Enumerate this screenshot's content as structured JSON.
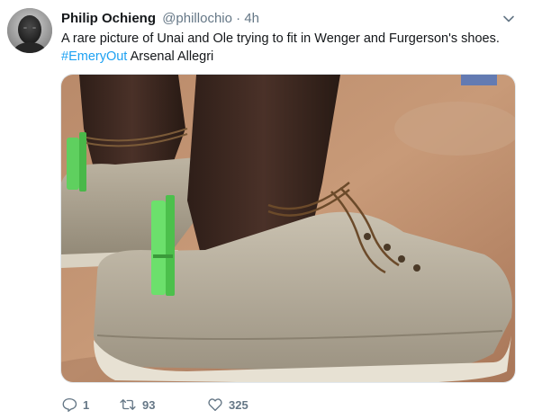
{
  "tweet": {
    "display_name": "Philip Ochieng",
    "handle": "@phillochio",
    "separator": "·",
    "time": "4h",
    "text_line1": "A rare picture of Unai and Ole trying to fit in Wenger and Furgerson's shoes.",
    "hashtag": "#EmeryOut",
    "text_rest": " Arsenal Allegri",
    "media_icon": "photo-of-shoes-tied-with-rope",
    "actions": {
      "reply_icon": "reply-icon",
      "reply_count": "1",
      "retweet_icon": "retweet-icon",
      "retweet_count": "93",
      "like_icon": "heart-icon",
      "like_count": "325"
    }
  },
  "colors": {
    "text": "#14171a",
    "muted": "#657786",
    "link": "#1da1f2",
    "border": "#e1e8ed"
  }
}
